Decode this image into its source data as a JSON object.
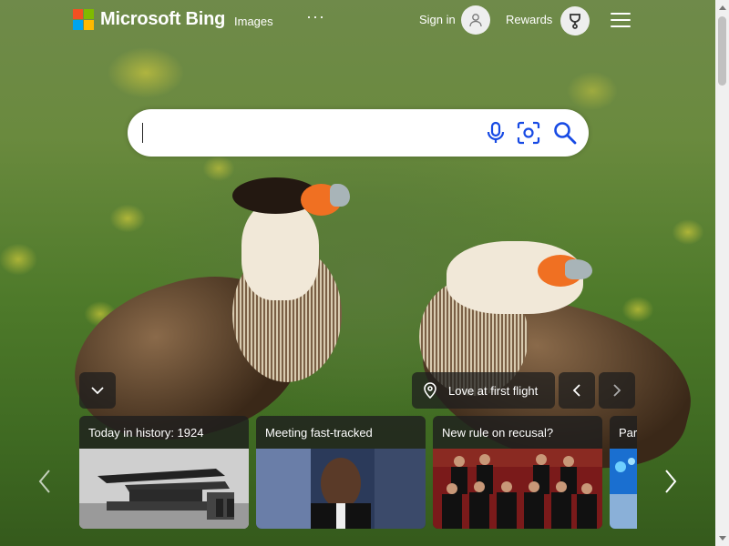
{
  "brand": {
    "name": "Microsoft Bing",
    "logo_colors": [
      "#f25022",
      "#7fba00",
      "#00a4ef",
      "#ffb900"
    ]
  },
  "header": {
    "nav_images": "Images",
    "nav_more": "···",
    "signin_label": "Sign in",
    "rewards_label": "Rewards"
  },
  "search": {
    "value": "",
    "icons": [
      "microphone-icon",
      "visual-search-icon",
      "search-icon"
    ],
    "accent": "#174ae4"
  },
  "carousel": {
    "location_label": "Love at first flight",
    "cards": [
      {
        "title": "Today in history: 1924"
      },
      {
        "title": "Meeting fast-tracked"
      },
      {
        "title": "New rule on recusal?"
      },
      {
        "title": "Par"
      }
    ]
  }
}
